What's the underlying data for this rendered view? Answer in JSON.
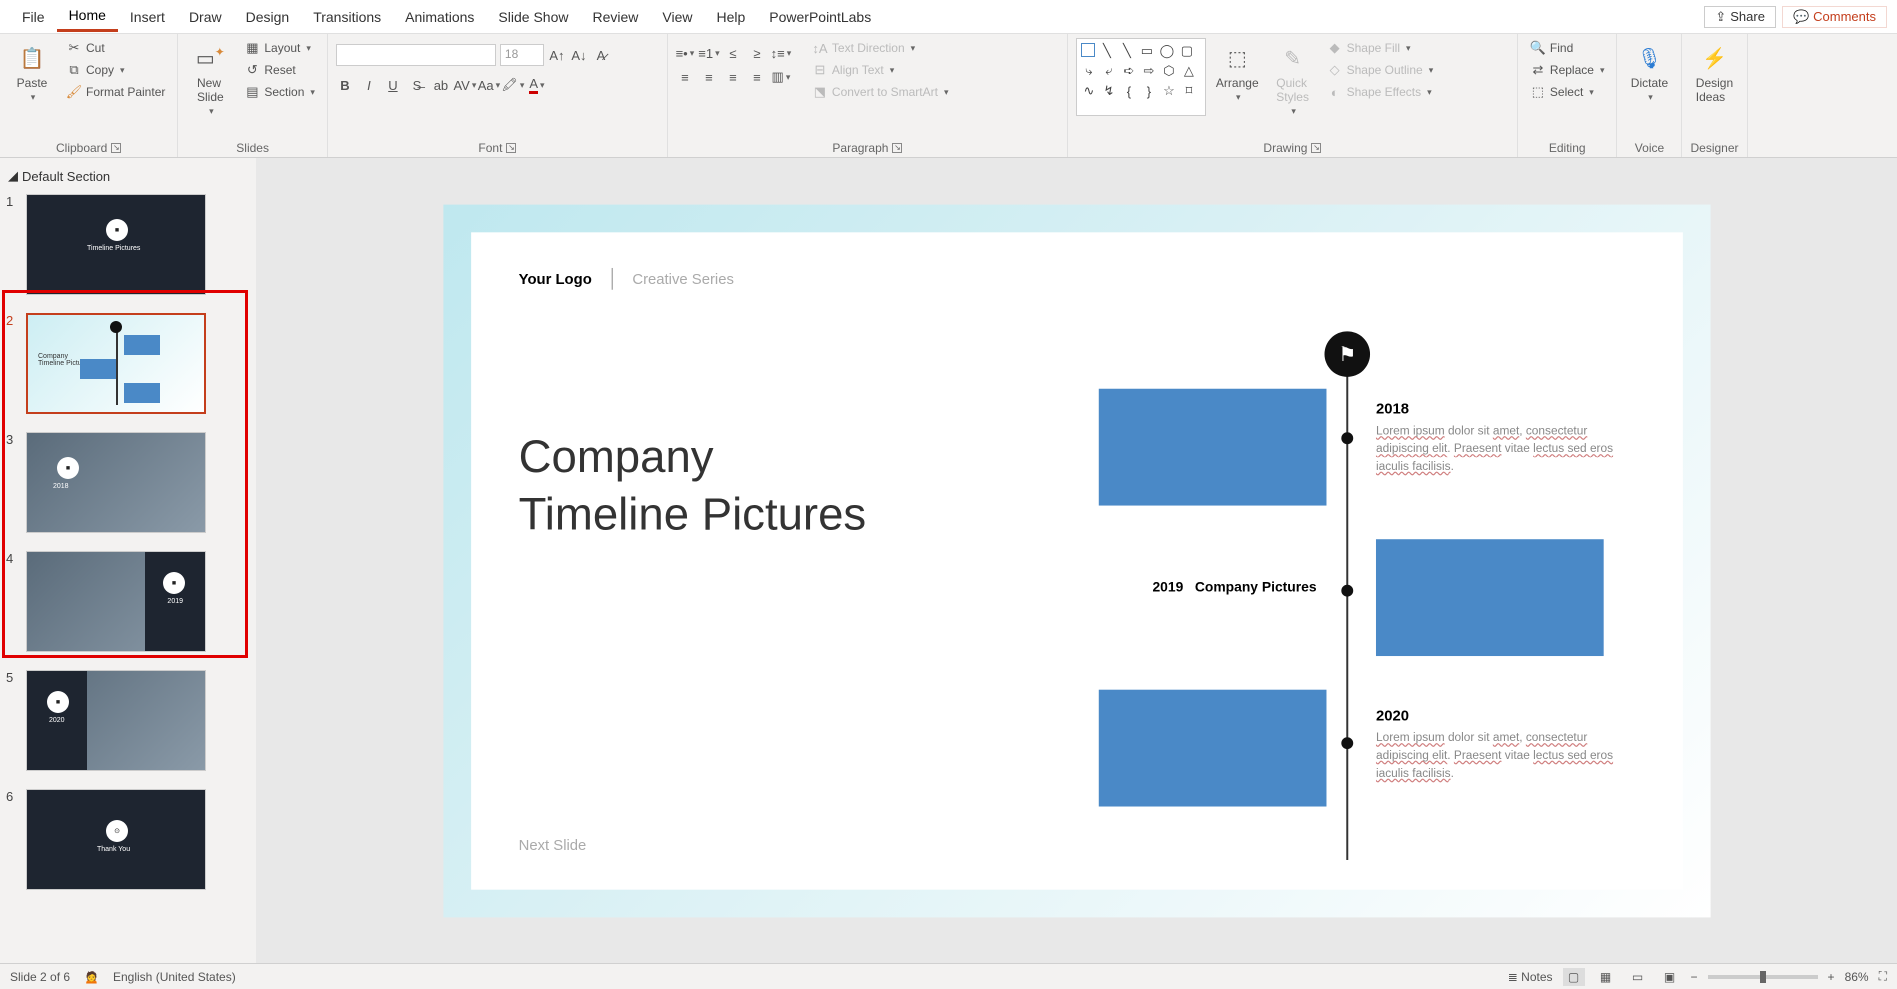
{
  "menu": {
    "tabs": [
      "File",
      "Home",
      "Insert",
      "Draw",
      "Design",
      "Transitions",
      "Animations",
      "Slide Show",
      "Review",
      "View",
      "Help",
      "PowerPointLabs"
    ],
    "active": 1,
    "share": "Share",
    "comments": "Comments"
  },
  "ribbon": {
    "clipboard": {
      "paste": "Paste",
      "cut": "Cut",
      "copy": "Copy",
      "format_painter": "Format Painter",
      "label": "Clipboard"
    },
    "slides": {
      "new_slide": "New\nSlide",
      "layout": "Layout",
      "reset": "Reset",
      "section": "Section",
      "label": "Slides"
    },
    "font": {
      "size": "18",
      "label": "Font"
    },
    "paragraph": {
      "text_direction": "Text Direction",
      "align_text": "Align Text",
      "convert_smartart": "Convert to SmartArt",
      "label": "Paragraph"
    },
    "drawing": {
      "arrange": "Arrange",
      "quick_styles": "Quick\nStyles",
      "shape_fill": "Shape Fill",
      "shape_outline": "Shape Outline",
      "shape_effects": "Shape Effects",
      "label": "Drawing"
    },
    "editing": {
      "find": "Find",
      "replace": "Replace",
      "select": "Select",
      "label": "Editing"
    },
    "voice": {
      "dictate": "Dictate",
      "label": "Voice"
    },
    "designer": {
      "design_ideas": "Design\nIdeas",
      "label": "Designer"
    }
  },
  "section_name": "Default Section",
  "thumbnails": [
    {
      "num": "1",
      "type": "dark",
      "title": "Timeline Pictures"
    },
    {
      "num": "2",
      "type": "timeline",
      "title": "Company Timeline Pictures"
    },
    {
      "num": "3",
      "type": "photo",
      "year": "2018"
    },
    {
      "num": "4",
      "type": "photo",
      "year": "2019"
    },
    {
      "num": "5",
      "type": "photo",
      "year": "2020"
    },
    {
      "num": "6",
      "type": "dark",
      "title": "Thank You"
    }
  ],
  "current_thumb": 1,
  "slide": {
    "logo": "Your Logo",
    "series": "Creative Series",
    "title_l1": "Company",
    "title_l2": "Timeline Pictures",
    "next_slide": "Next Slide",
    "timeline": {
      "2018": {
        "year": "2018",
        "text": "Lorem ipsum dolor sit amet, consectetur adipiscing elit. Praesent vitae lectus sed eros iaculis facilisis."
      },
      "2019": {
        "year": "2019",
        "label": "Company Pictures"
      },
      "2020": {
        "year": "2020",
        "text": "Lorem ipsum dolor sit amet, consectetur adipiscing elit. Praesent vitae lectus sed eros iaculis facilisis."
      }
    }
  },
  "status": {
    "slide_pos": "Slide 2 of 6",
    "lang": "English (United States)",
    "notes": "Notes",
    "zoom": "86%"
  }
}
